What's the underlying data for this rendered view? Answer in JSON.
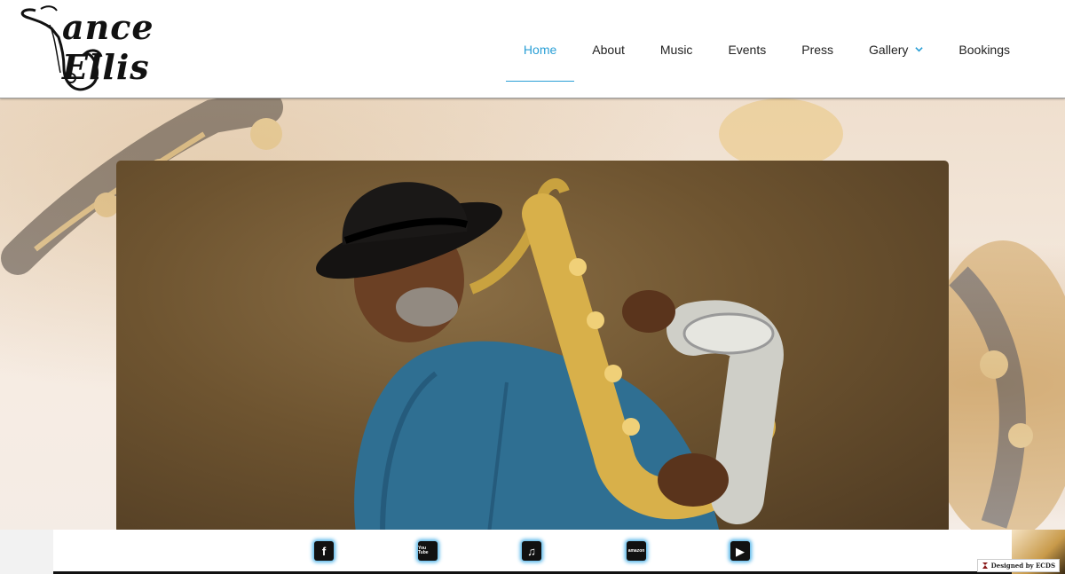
{
  "brand": {
    "name": "ance Ellis"
  },
  "nav": {
    "items": [
      {
        "label": "Home",
        "active": true
      },
      {
        "label": "About",
        "active": false
      },
      {
        "label": "Music",
        "active": false
      },
      {
        "label": "Events",
        "active": false
      },
      {
        "label": "Press",
        "active": false
      },
      {
        "label": "Gallery",
        "active": false,
        "dropdown": true
      },
      {
        "label": "Bookings",
        "active": false
      }
    ]
  },
  "social": [
    {
      "name": "facebook",
      "glyph": "f"
    },
    {
      "name": "youtube",
      "glyph": "You Tube"
    },
    {
      "name": "itunes",
      "glyph": "♫"
    },
    {
      "name": "amazon",
      "glyph": "amazon"
    },
    {
      "name": "google-play",
      "glyph": "▶"
    }
  ],
  "footer": {
    "credit": "Designed by ECDS"
  },
  "colors": {
    "accent": "#2a9fd6",
    "glow": "#4fb3e8"
  }
}
